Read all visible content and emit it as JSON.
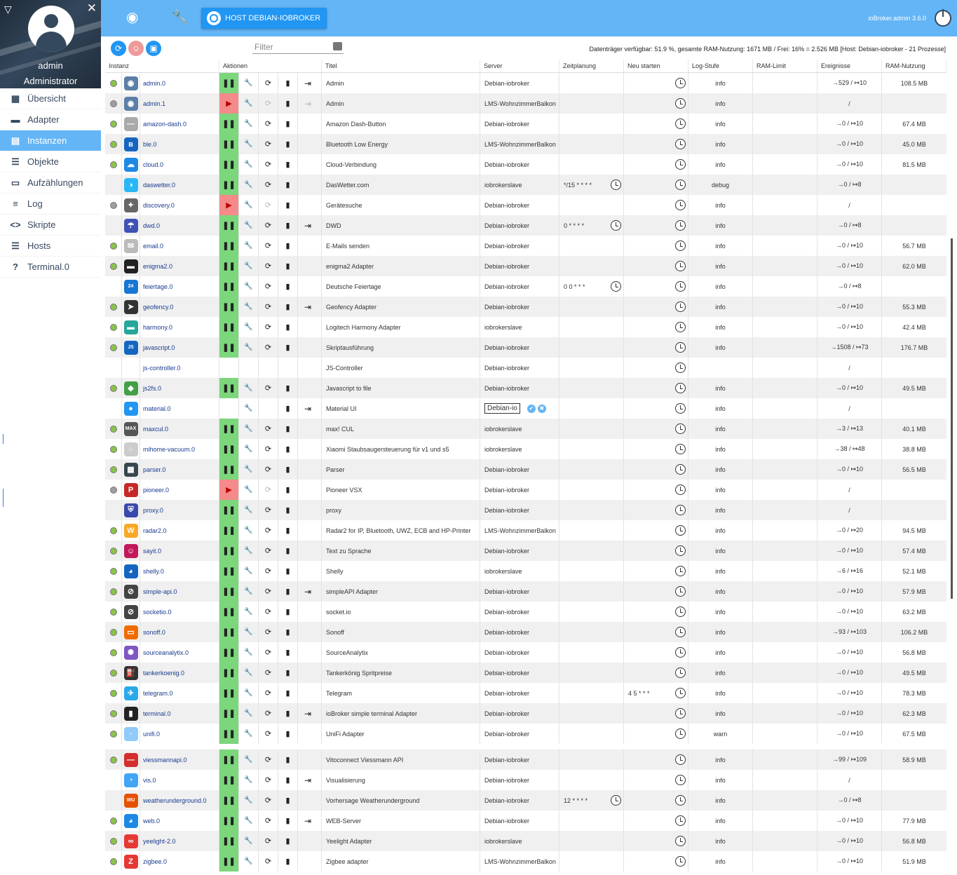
{
  "sidebar": {
    "user": "admin",
    "role": "Administrator",
    "items": [
      {
        "label": "Übersicht",
        "icon": "grid-icon",
        "glyph": "▦"
      },
      {
        "label": "Adapter",
        "icon": "store-icon",
        "glyph": "▬"
      },
      {
        "label": "Instanzen",
        "icon": "instances-icon",
        "glyph": "▤",
        "active": true
      },
      {
        "label": "Objekte",
        "icon": "list-icon",
        "glyph": "☰"
      },
      {
        "label": "Aufzählungen",
        "icon": "enum-icon",
        "glyph": "▭"
      },
      {
        "label": "Log",
        "icon": "log-icon",
        "glyph": "≡"
      },
      {
        "label": "Skripte",
        "icon": "code-icon",
        "glyph": "<>"
      },
      {
        "label": "Hosts",
        "icon": "hosts-icon",
        "glyph": "☰"
      },
      {
        "label": "Terminal.0",
        "icon": "terminal-icon",
        "glyph": "?"
      }
    ]
  },
  "topbar": {
    "host_button": "HOST DEBIAN-IOBROKER",
    "version": "ioBroker.admin 3.6.0"
  },
  "toolbar": {
    "filter_placeholder": "Filter",
    "status": "Datenträger verfügbar: 51.9 %, gesamte RAM-Nutzung: 1671 MB / Frei: 16% = 2.526 MB [Host: Debian-iobroker - 21 Prozesse]"
  },
  "columns": [
    "Instanz",
    "Aktionen",
    "Titel",
    "Server",
    "Zeitplanung",
    "Neu starten",
    "Log-Stufe",
    "RAM-Limit",
    "Ereignisse",
    "RAM-Nutzung"
  ],
  "colors": {
    "accent": "#64b5f6",
    "running": "#7cd67c",
    "stopped": "#f48a8a",
    "brand": "#2196f3"
  },
  "instances": [
    {
      "dot": "g",
      "icon": "◉",
      "ic": "#5b7fa6",
      "name": "admin.0",
      "s": "run",
      "cfg": true,
      "link": true,
      "title": "Admin",
      "server": "Debian-iobroker",
      "sched": "",
      "log": "info",
      "events": "→529 / ↦10",
      "ram": "108.5 MB"
    },
    {
      "dot": "x",
      "icon": "◉",
      "ic": "#5b7fa6",
      "name": "admin.1",
      "s": "stop",
      "cfg": true,
      "link": true,
      "title": "Admin",
      "server": "LMS-WohnzimmerBalkon",
      "sched": "",
      "log": "info",
      "events": "/",
      "ram": ""
    },
    {
      "dot": "g",
      "icon": "—",
      "ic": "#aaa",
      "name": "amazon-dash.0",
      "s": "run",
      "cfg": true,
      "link": false,
      "title": "Amazon Dash-Button",
      "server": "Debian-iobroker",
      "sched": "",
      "log": "info",
      "events": "→0 / ↦10",
      "ram": "67.4 MB"
    },
    {
      "dot": "g",
      "icon": "ʙ",
      "ic": "#1565c0",
      "name": "ble.0",
      "s": "run",
      "cfg": true,
      "link": false,
      "title": "Bluetooth Low Energy",
      "server": "LMS-WohnzimmerBalkon",
      "sched": "",
      "log": "info",
      "events": "→0 / ↦10",
      "ram": "45.0 MB"
    },
    {
      "dot": "g",
      "icon": "☁",
      "ic": "#1e88e5",
      "name": "cloud.0",
      "s": "run",
      "cfg": true,
      "link": false,
      "title": "Cloud-Verbindung",
      "server": "Debian-iobroker",
      "sched": "",
      "log": "info",
      "events": "→0 / ↦10",
      "ram": "81.5 MB"
    },
    {
      "dot": "",
      "icon": "◑",
      "ic": "#29b6f6",
      "name": "daswetter.0",
      "s": "run",
      "cfg": true,
      "link": false,
      "title": "DasWetter.com",
      "server": "iobrokerslave",
      "sched": "*/15 * * * *",
      "log": "debug",
      "events": "→0 / ↦8",
      "ram": ""
    },
    {
      "dot": "x",
      "icon": "✦",
      "ic": "#666",
      "name": "discovery.0",
      "s": "stop",
      "cfg": true,
      "link": false,
      "title": "Gerätesuche",
      "server": "Debian-iobroker",
      "sched": "",
      "log": "info",
      "events": "/",
      "ram": ""
    },
    {
      "dot": "",
      "icon": "☂",
      "ic": "#3f51b5",
      "name": "dwd.0",
      "s": "run",
      "cfg": true,
      "link": true,
      "title": "DWD",
      "server": "Debian-iobroker",
      "sched": "0 * * * *",
      "log": "info",
      "events": "→0 / ↦8",
      "ram": ""
    },
    {
      "dot": "g",
      "icon": "✉",
      "ic": "#bbb",
      "name": "email.0",
      "s": "run",
      "cfg": true,
      "link": false,
      "title": "E-Mails senden",
      "server": "Debian-iobroker",
      "sched": "",
      "log": "info",
      "events": "→0 / ↦10",
      "ram": "56.7 MB"
    },
    {
      "dot": "g",
      "icon": "▬",
      "ic": "#222",
      "name": "enigma2.0",
      "s": "run",
      "cfg": true,
      "link": false,
      "title": "enigma2 Adapter",
      "server": "Debian-iobroker",
      "sched": "",
      "log": "info",
      "events": "→0 / ↦10",
      "ram": "62.0 MB"
    },
    {
      "dot": "",
      "icon": "24",
      "ic": "#1976d2",
      "name": "feiertage.0",
      "s": "run",
      "cfg": true,
      "link": false,
      "title": "Deutsche Feiertage",
      "server": "Debian-iobroker",
      "sched": "0 0 * * *",
      "log": "info",
      "events": "→0 / ↦8",
      "ram": ""
    },
    {
      "dot": "g",
      "icon": "➤",
      "ic": "#333",
      "name": "geofency.0",
      "s": "run",
      "cfg": true,
      "link": true,
      "title": "Geofency Adapter",
      "server": "Debian-iobroker",
      "sched": "",
      "log": "info",
      "events": "→0 / ↦10",
      "ram": "55.3 MB"
    },
    {
      "dot": "g",
      "icon": "▬",
      "ic": "#26a69a",
      "name": "harmony.0",
      "s": "run",
      "cfg": true,
      "link": false,
      "title": "Logitech Harmony Adapter",
      "server": "iobrokerslave",
      "sched": "",
      "log": "info",
      "events": "→0 / ↦10",
      "ram": "42.4 MB"
    },
    {
      "dot": "g",
      "icon": "JS",
      "ic": "#1565c0",
      "name": "javascript.0",
      "s": "run",
      "cfg": true,
      "link": false,
      "title": "Skriptausführung",
      "server": "Debian-iobroker",
      "sched": "",
      "log": "info",
      "events": "→1508 / ↦73",
      "ram": "176.7 MB"
    },
    {
      "dot": "",
      "icon": "",
      "ic": "",
      "name": "js-controller.0",
      "s": "none",
      "cfg": false,
      "link": false,
      "title": "JS-Controller",
      "server": "Debian-iobroker",
      "sched": "",
      "log": "",
      "events": "/",
      "ram": ""
    },
    {
      "dot": "g",
      "icon": "◆",
      "ic": "#43a047",
      "name": "js2fs.0",
      "s": "run",
      "cfg": true,
      "link": false,
      "title": "Javascript to file",
      "server": "Debian-iobroker",
      "sched": "",
      "log": "info",
      "events": "→0 / ↦10",
      "ram": "49.5 MB"
    },
    {
      "dot": "",
      "icon": "●",
      "ic": "#2196f3",
      "name": "material.0",
      "s": "edit",
      "cfg": true,
      "link": true,
      "title": "Material UI",
      "server": "Debian-io",
      "sched": "",
      "log": "info",
      "events": "/",
      "ram": ""
    },
    {
      "dot": "g",
      "icon": "MAX",
      "ic": "#555",
      "name": "maxcul.0",
      "s": "run",
      "cfg": true,
      "link": false,
      "title": "max! CUL",
      "server": "iobrokerslave",
      "sched": "",
      "log": "info",
      "events": "→3 / ↦13",
      "ram": "40.1 MB"
    },
    {
      "dot": "g",
      "icon": "○",
      "ic": "#ccc",
      "name": "mihome-vacuum.0",
      "s": "run",
      "cfg": true,
      "link": false,
      "title": "Xiaomi Staubsaugersteuerung für v1 und s5",
      "server": "iobrokerslave",
      "sched": "",
      "log": "info",
      "events": "→38 / ↦48",
      "ram": "38.8 MB"
    },
    {
      "dot": "g",
      "icon": "▦",
      "ic": "#37474f",
      "name": "parser.0",
      "s": "run",
      "cfg": true,
      "link": false,
      "title": "Parser",
      "server": "Debian-iobroker",
      "sched": "",
      "log": "info",
      "events": "→0 / ↦10",
      "ram": "56.5 MB"
    },
    {
      "dot": "x",
      "icon": "P",
      "ic": "#c62828",
      "name": "pioneer.0",
      "s": "stop",
      "cfg": true,
      "link": false,
      "title": "Pioneer VSX",
      "server": "Debian-iobroker",
      "sched": "",
      "log": "info",
      "events": "/",
      "ram": ""
    },
    {
      "dot": "",
      "icon": "⛨",
      "ic": "#3949ab",
      "name": "proxy.0",
      "s": "run",
      "cfg": true,
      "link": false,
      "title": "proxy",
      "server": "Debian-iobroker",
      "sched": "",
      "log": "info",
      "events": "/",
      "ram": ""
    },
    {
      "dot": "g",
      "icon": "W",
      "ic": "#f9a825",
      "name": "radar2.0",
      "s": "run",
      "cfg": true,
      "link": false,
      "title": "Radar2 for IP, Bluetooth, UWZ, ECB and HP-Printer",
      "server": "LMS-WohnzimmerBalkon",
      "sched": "",
      "log": "info",
      "events": "→0 / ↦20",
      "ram": "94.5 MB"
    },
    {
      "dot": "g",
      "icon": "☺",
      "ic": "#c2185b",
      "name": "sayit.0",
      "s": "run",
      "cfg": true,
      "link": false,
      "title": "Text zu Sprache",
      "server": "Debian-iobroker",
      "sched": "",
      "log": "info",
      "events": "→0 / ↦10",
      "ram": "57.4 MB"
    },
    {
      "dot": "g",
      "icon": "◕",
      "ic": "#1565c0",
      "name": "shelly.0",
      "s": "run",
      "cfg": true,
      "link": false,
      "title": "Shelly",
      "server": "iobrokerslave",
      "sched": "",
      "log": "info",
      "events": "→6 / ↦16",
      "ram": "52.1 MB"
    },
    {
      "dot": "g",
      "icon": "⊘",
      "ic": "#444",
      "name": "simple-api.0",
      "s": "run",
      "cfg": true,
      "link": true,
      "title": "simpleAPI Adapter",
      "server": "Debian-iobroker",
      "sched": "",
      "log": "info",
      "events": "→0 / ↦10",
      "ram": "57.9 MB"
    },
    {
      "dot": "g",
      "icon": "⊘",
      "ic": "#444",
      "name": "socketio.0",
      "s": "run",
      "cfg": true,
      "link": false,
      "title": "socket.io",
      "server": "Debian-iobroker",
      "sched": "",
      "log": "info",
      "events": "→0 / ↦10",
      "ram": "63.2 MB"
    },
    {
      "dot": "g",
      "icon": "▭",
      "ic": "#ef6c00",
      "name": "sonoff.0",
      "s": "run",
      "cfg": true,
      "link": false,
      "title": "Sonoff",
      "server": "Debian-iobroker",
      "sched": "",
      "log": "info",
      "events": "→93 / ↦103",
      "ram": "106.2 MB"
    },
    {
      "dot": "g",
      "icon": "✺",
      "ic": "#7e57c2",
      "name": "sourceanalytix.0",
      "s": "run",
      "cfg": true,
      "link": false,
      "title": "SourceAnalytix",
      "server": "Debian-iobroker",
      "sched": "",
      "log": "info",
      "events": "→0 / ↦10",
      "ram": "56.8 MB"
    },
    {
      "dot": "g",
      "icon": "⛽",
      "ic": "#333",
      "name": "tankerkoenig.0",
      "s": "run",
      "cfg": true,
      "link": false,
      "title": "Tankerkönig Spritpreise",
      "server": "Debian-iobroker",
      "sched": "",
      "log": "info",
      "events": "→0 / ↦10",
      "ram": "49.5 MB"
    },
    {
      "dot": "g",
      "icon": "✈",
      "ic": "#29a9eb",
      "name": "telegram.0",
      "s": "run",
      "cfg": true,
      "link": false,
      "title": "Telegram",
      "server": "Debian-iobroker",
      "sched": "",
      "restart": "4 5 * * *",
      "log": "info",
      "events": "→0 / ↦10",
      "ram": "78.3 MB"
    },
    {
      "dot": "g",
      "icon": "▮",
      "ic": "#222",
      "name": "terminal.0",
      "s": "run",
      "cfg": true,
      "link": true,
      "title": "ioBroker simple terminal Adapter",
      "server": "Debian-iobroker",
      "sched": "",
      "log": "info",
      "events": "→0 / ↦10",
      "ram": "62.3 MB"
    },
    {
      "dot": "g",
      "icon": "◦",
      "ic": "#90caf9",
      "name": "unifi.0",
      "s": "run",
      "cfg": true,
      "link": false,
      "title": "UniFi Adapter",
      "server": "Debian-iobroker",
      "sched": "",
      "log": "warn",
      "events": "→0 / ↦10",
      "ram": "67.5 MB"
    },
    {
      "dot": "g",
      "icon": "—",
      "ic": "#d32f2f",
      "name": "viessmannapi.0",
      "s": "run",
      "cfg": true,
      "link": false,
      "title": "Vitoconnect Viessmann API",
      "server": "Debian-iobroker",
      "sched": "",
      "log": "info",
      "events": "→99 / ↦109",
      "ram": "58.9 MB"
    },
    {
      "dot": "",
      "icon": "◔",
      "ic": "#42a5f5",
      "name": "vis.0",
      "s": "run",
      "cfg": true,
      "link": true,
      "title": "Visualisierung",
      "server": "Debian-iobroker",
      "sched": "",
      "log": "info",
      "events": "/",
      "ram": ""
    },
    {
      "dot": "",
      "icon": "WU",
      "ic": "#e65100",
      "name": "weatherunderground.0",
      "s": "run",
      "cfg": true,
      "link": false,
      "title": "Vorhersage Weatherunderground",
      "server": "Debian-iobroker",
      "sched": "12 * * * *",
      "log": "info",
      "events": "→0 / ↦8",
      "ram": ""
    },
    {
      "dot": "g",
      "icon": "◕",
      "ic": "#1e88e5",
      "name": "web.0",
      "s": "run",
      "cfg": true,
      "link": true,
      "title": "WEB-Server",
      "server": "Debian-iobroker",
      "sched": "",
      "log": "info",
      "events": "→0 / ↦10",
      "ram": "77.9 MB"
    },
    {
      "dot": "g",
      "icon": "∞",
      "ic": "#e53935",
      "name": "yeelight-2.0",
      "s": "run",
      "cfg": true,
      "link": false,
      "title": "Yeelight Adapter",
      "server": "iobrokerslave",
      "sched": "",
      "log": "info",
      "events": "→0 / ↦10",
      "ram": "56.8 MB"
    },
    {
      "dot": "g",
      "icon": "Z",
      "ic": "#e53935",
      "name": "zigbee.0",
      "s": "run",
      "cfg": true,
      "link": false,
      "title": "Zigbee adapter",
      "server": "LMS-WohnzimmerBalkon",
      "sched": "",
      "log": "info",
      "events": "→0 / ↦10",
      "ram": "51.9 MB"
    }
  ]
}
